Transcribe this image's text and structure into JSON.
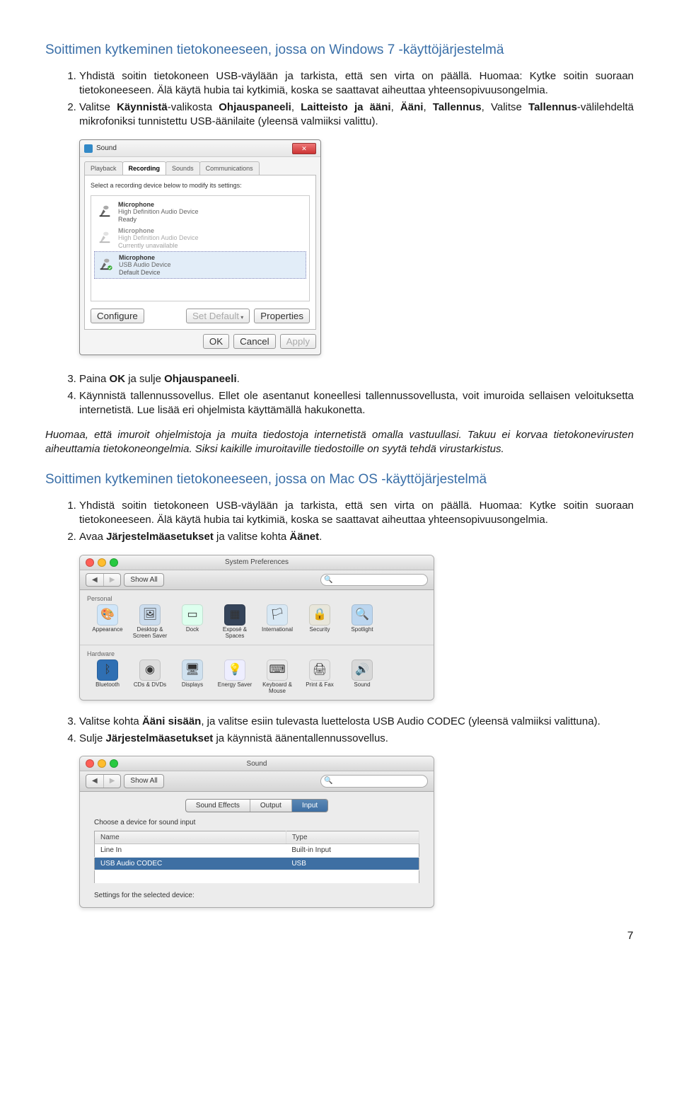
{
  "heading_win": "Soittimen kytkeminen tietokoneeseen, jossa on Windows 7 -käyttöjärjestelmä",
  "step_win_1": "Yhdistä soitin tietokoneen USB-väylään ja tarkista, että sen virta on päällä. Huomaa: Kytke soitin suoraan tietokoneeseen. Älä käytä hubia tai kytkimiä, koska se saattavat aiheuttaa yhteensopivuusongelmia.",
  "step_win_2a": "Valitse ",
  "step_win_2b": "Käynnistä",
  "step_win_2c": "-valikosta ",
  "step_win_2d": "Ohjauspaneeli",
  "step_win_2e": ", ",
  "step_win_2f": "Laitteisto ja ääni",
  "step_win_2g": ", ",
  "step_win_2h": "Ääni",
  "step_win_2i": ", ",
  "step_win_2j": "Tallennus",
  "step_win_2k": ", Valitse ",
  "step_win_2l": "Tallennus",
  "step_win_2m": "-välilehdeltä mikrofoniksi tunnistettu USB-äänilaite (yleensä valmiiksi valittu).",
  "sound_dialog": {
    "title": "Sound",
    "tabs": [
      "Playback",
      "Recording",
      "Sounds",
      "Communications"
    ],
    "instruction": "Select a recording device below to modify its settings:",
    "devices": [
      {
        "name": "Microphone",
        "sub": "High Definition Audio Device",
        "status": "Ready"
      },
      {
        "name": "Microphone",
        "sub": "High Definition Audio Device",
        "status": "Currently unavailable"
      },
      {
        "name": "Microphone",
        "sub": "USB Audio Device",
        "status": "Default Device"
      }
    ],
    "configure": "Configure",
    "set_default": "Set Default",
    "properties": "Properties",
    "ok": "OK",
    "cancel": "Cancel",
    "apply": "Apply"
  },
  "step_win_3a": "Paina ",
  "step_win_3b": "OK",
  "step_win_3c": " ja sulje ",
  "step_win_3d": "Ohjauspaneeli",
  "step_win_3e": ".",
  "step_win_4": "Käynnistä tallennussovellus. Ellet ole asentanut koneellesi tallennussovellusta, voit imuroida sellaisen veloituksetta internetistä. Lue lisää eri ohjelmista käyttämällä hakukonetta.",
  "disclaimer": "Huomaa, että imuroit ohjelmistoja ja muita tiedostoja internetistä omalla vastuullasi. Takuu ei korvaa tietokonevirusten aiheuttamia tietokoneongelmia. Siksi kaikille imuroitaville tiedostoille on syytä tehdä virustarkistus.",
  "heading_mac": "Soittimen kytkeminen tietokoneeseen, jossa on Mac OS -käyttöjärjestelmä",
  "step_mac_1": "Yhdistä soitin tietokoneen USB-väylään ja tarkista, että sen virta on päällä. Huomaa: Kytke soitin suoraan tietokoneeseen. Älä käytä hubia tai kytkimiä, koska se saattavat aiheuttaa yhteensopivuusongelmia.",
  "step_mac_2a": "Avaa ",
  "step_mac_2b": "Järjestelmäasetukset",
  "step_mac_2c": " ja valitse kohta ",
  "step_mac_2d": "Äänet",
  "step_mac_2e": ".",
  "mac_prefs": {
    "title": "System Preferences",
    "show_all": "Show All",
    "search_placeholder": "",
    "personal_label": "Personal",
    "personal": [
      {
        "name": "Appearance",
        "glyph": "🎨",
        "bg": "#d0e6f9"
      },
      {
        "name": "Desktop & Screen Saver",
        "glyph": "🖼",
        "bg": "#cde"
      },
      {
        "name": "Dock",
        "glyph": "▭",
        "bg": "#dfe"
      },
      {
        "name": "Exposé & Spaces",
        "glyph": "▦",
        "bg": "#35445a"
      },
      {
        "name": "International",
        "glyph": "🏳",
        "bg": "#d8e8f4"
      },
      {
        "name": "Security",
        "glyph": "🔒",
        "bg": "#e8e6da"
      },
      {
        "name": "Spotlight",
        "glyph": "🔍",
        "bg": "#bcd6ef"
      }
    ],
    "hardware_label": "Hardware",
    "hardware": [
      {
        "name": "Bluetooth",
        "glyph": "ᛒ",
        "bg": "#2f6fb3"
      },
      {
        "name": "CDs & DVDs",
        "glyph": "◉",
        "bg": "#ddd"
      },
      {
        "name": "Displays",
        "glyph": "🖥",
        "bg": "#cfe1ef"
      },
      {
        "name": "Energy Saver",
        "glyph": "💡",
        "bg": "#eef"
      },
      {
        "name": "Keyboard & Mouse",
        "glyph": "⌨",
        "bg": "#e8e8e8"
      },
      {
        "name": "Print & Fax",
        "glyph": "🖨",
        "bg": "#e6e6e6"
      },
      {
        "name": "Sound",
        "glyph": "🔊",
        "bg": "#d8d8d8"
      }
    ]
  },
  "step_mac_3a": "Valitse kohta ",
  "step_mac_3b": "Ääni sisään",
  "step_mac_3c": ", ja valitse esiin tulevasta luettelosta USB Audio CODEC (yleensä valmiiksi valittuna).",
  "step_mac_4a": "Sulje ",
  "step_mac_4b": "Järjestelmäasetukset",
  "step_mac_4c": " ja käynnistä äänentallennussovellus.",
  "mac_sound": {
    "title": "Sound",
    "show_all": "Show All",
    "tabs": [
      "Sound Effects",
      "Output",
      "Input"
    ],
    "choose": "Choose a device for sound input",
    "col_name": "Name",
    "col_type": "Type",
    "rows": [
      {
        "name": "Line In",
        "type": "Built-in Input"
      },
      {
        "name": "USB Audio CODEC",
        "type": "USB"
      }
    ],
    "settings": "Settings for the selected device:"
  },
  "page_number": "7"
}
